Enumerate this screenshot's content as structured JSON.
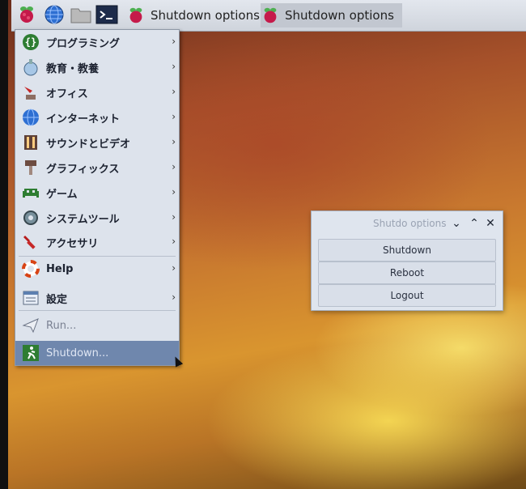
{
  "taskbar": {
    "tasks": [
      {
        "label": "Shutdown options"
      },
      {
        "label": "Shutdown options"
      }
    ]
  },
  "menu": {
    "items": [
      {
        "label": "プログラミング",
        "icon": "programming-icon"
      },
      {
        "label": "教育・教養",
        "icon": "education-icon"
      },
      {
        "label": "オフィス",
        "icon": "office-icon"
      },
      {
        "label": "インターネット",
        "icon": "internet-globe-icon"
      },
      {
        "label": "サウンドとビデオ",
        "icon": "sound-video-icon"
      },
      {
        "label": "グラフィックス",
        "icon": "graphics-icon"
      },
      {
        "label": "ゲーム",
        "icon": "game-icon"
      },
      {
        "label": "システムツール",
        "icon": "system-tools-icon"
      },
      {
        "label": "アクセサリ",
        "icon": "accessories-icon"
      },
      {
        "label": "Help",
        "icon": "help-lifebuoy-icon"
      },
      {
        "label": "設定",
        "icon": "settings-icon"
      },
      {
        "label": "Run...",
        "icon": "run-paperplane-icon"
      },
      {
        "label": "Shutdown...",
        "icon": "shutdown-exit-icon"
      }
    ],
    "arrow": "›"
  },
  "dialog": {
    "title": "Shutdo options",
    "buttons": {
      "shutdown": "Shutdown",
      "reboot": "Reboot",
      "logout": "Logout"
    },
    "controls": {
      "minimize": "⌄",
      "maximize": "⌃",
      "close": "✕"
    }
  }
}
